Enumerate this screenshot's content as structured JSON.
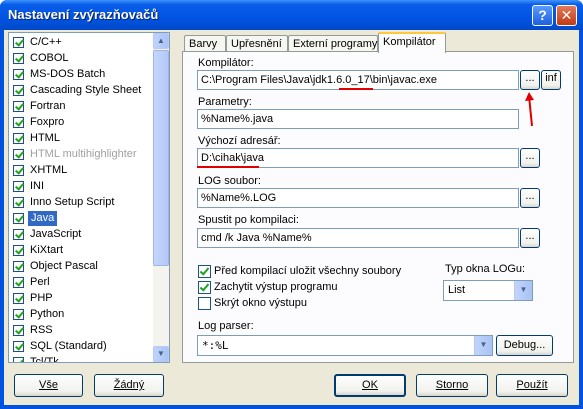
{
  "window": {
    "title": "Nastavení zvýrazňovačů",
    "help_glyph": "?",
    "close_glyph": "✕"
  },
  "languages": [
    {
      "label": "C/C++",
      "checked": true
    },
    {
      "label": "COBOL",
      "checked": true
    },
    {
      "label": "MS-DOS Batch",
      "checked": true
    },
    {
      "label": "Cascading Style Sheet",
      "checked": true
    },
    {
      "label": "Fortran",
      "checked": true
    },
    {
      "label": "Foxpro",
      "checked": true
    },
    {
      "label": "HTML",
      "checked": true
    },
    {
      "label": "HTML multihighlighter",
      "checked": true,
      "disabled": true
    },
    {
      "label": "XHTML",
      "checked": true
    },
    {
      "label": "INI",
      "checked": true
    },
    {
      "label": "Inno Setup Script",
      "checked": true
    },
    {
      "label": "Java",
      "checked": true,
      "selected": true
    },
    {
      "label": "JavaScript",
      "checked": true
    },
    {
      "label": "KiXtart",
      "checked": true
    },
    {
      "label": "Object Pascal",
      "checked": true
    },
    {
      "label": "Perl",
      "checked": true
    },
    {
      "label": "PHP",
      "checked": true
    },
    {
      "label": "Python",
      "checked": true
    },
    {
      "label": "RSS",
      "checked": true
    },
    {
      "label": "SQL (Standard)",
      "checked": true
    },
    {
      "label": "Tcl/Tk",
      "checked": true
    }
  ],
  "tabs": [
    "Barvy",
    "Upřesnění",
    "Externí programy",
    "Kompilátor"
  ],
  "active_tab": "Kompilátor",
  "compiler": {
    "label": "Kompilátor:",
    "value": "C:\\Program Files\\Java\\jdk1.6.0_17\\bin\\javac.exe",
    "browse": "...",
    "info": "inf"
  },
  "params": {
    "label": "Parametry:",
    "value": "%Name%.java"
  },
  "workdir": {
    "label": "Výchozí adresář:",
    "value": "D:\\cihak\\java",
    "browse": "..."
  },
  "logfile": {
    "label": "LOG soubor:",
    "value": "%Name%.LOG",
    "browse": "..."
  },
  "postrun": {
    "label": "Spustit po kompilaci:",
    "value": "cmd /k Java %Name%",
    "browse": "..."
  },
  "options": [
    {
      "label": "Před kompilací uložit všechny soubory",
      "checked": true
    },
    {
      "label": "Zachytit výstup programu",
      "checked": true
    },
    {
      "label": "Skrýt okno výstupu",
      "checked": false
    }
  ],
  "log_window": {
    "label": "Typ okna LOGu:",
    "value": "List"
  },
  "log_parser": {
    "label": "Log parser:",
    "value": "*:%L",
    "debug": "Debug..."
  },
  "buttons": {
    "all": "Vše",
    "none": "Žádný",
    "ok": "OK",
    "cancel": "Storno",
    "apply": "Použít"
  },
  "accent_colors": {
    "titlebar": "#0054e3",
    "selection": "#316ac5",
    "annotation": "#e00000"
  }
}
